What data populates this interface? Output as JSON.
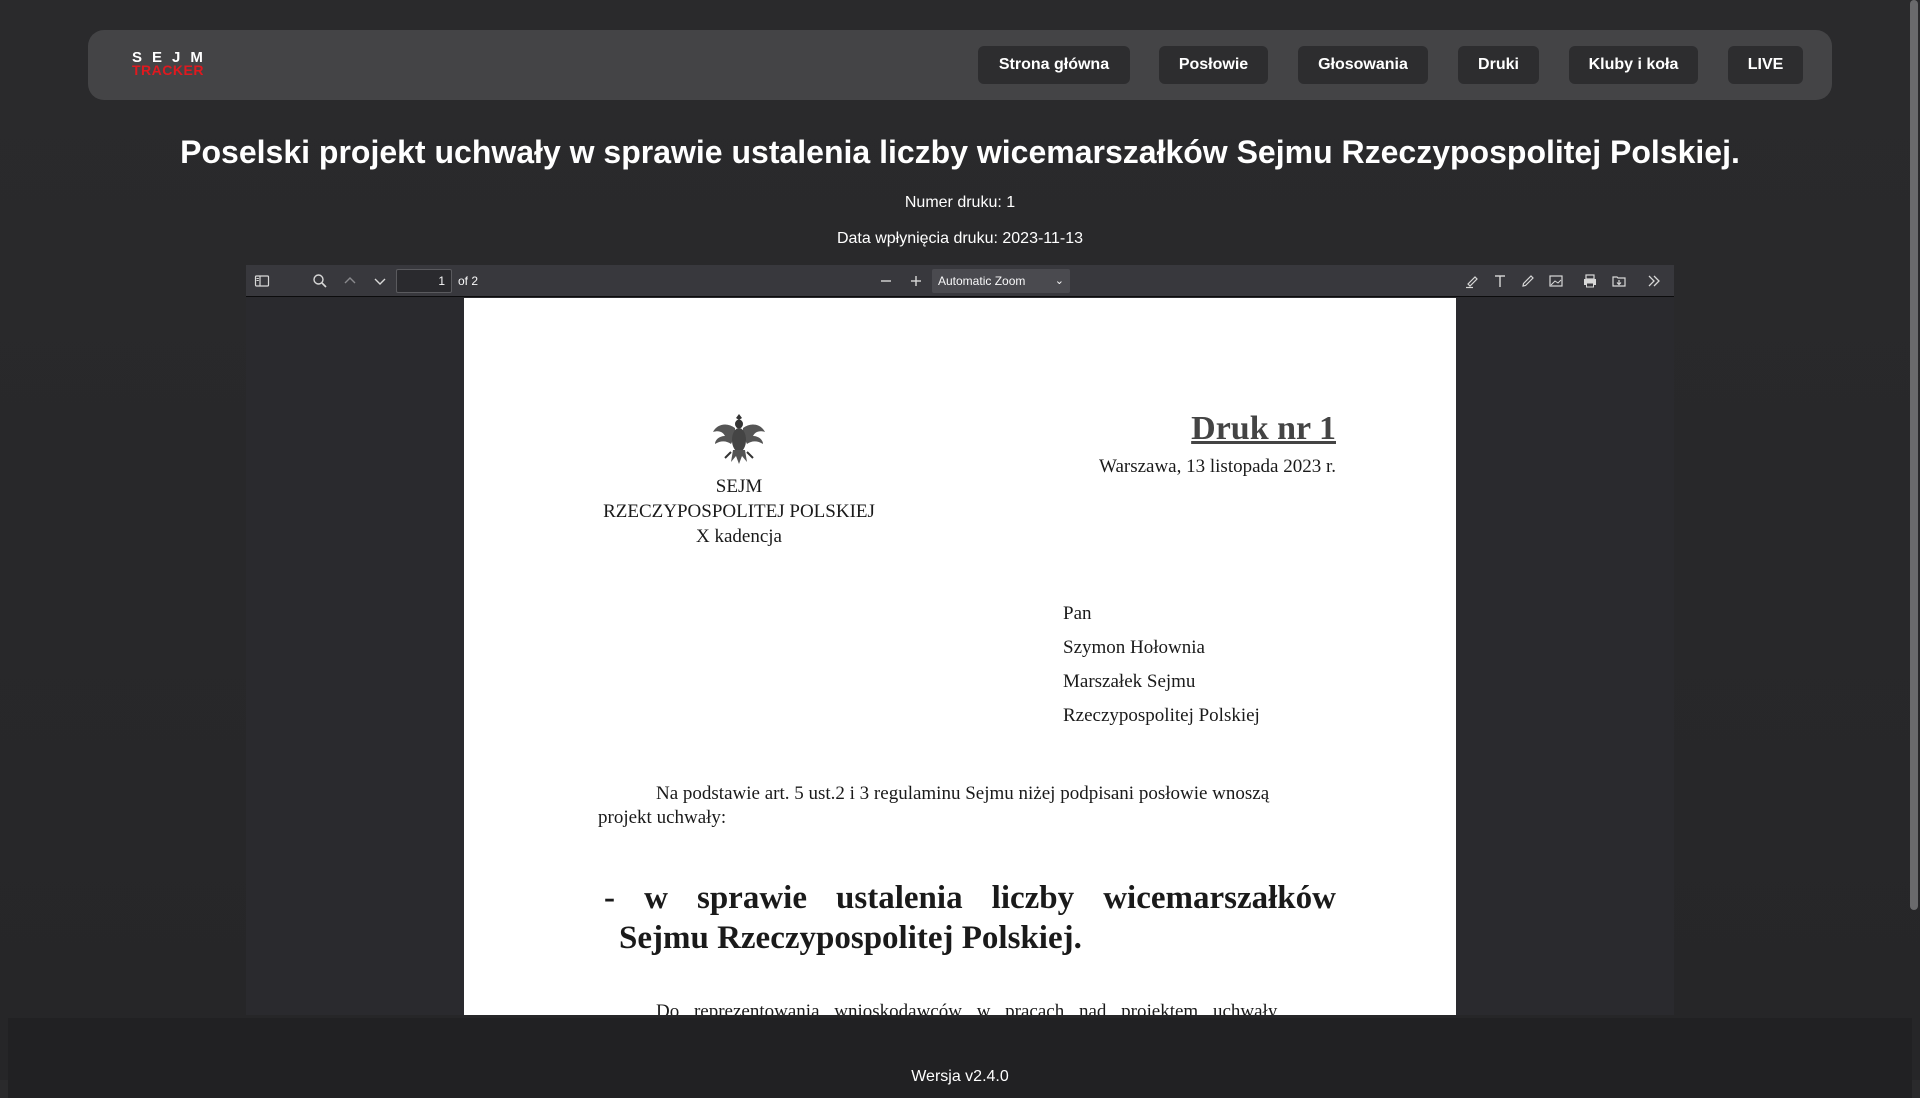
{
  "logo": {
    "top": "SEJM",
    "bottom": "TRACKER"
  },
  "nav": {
    "items": [
      {
        "label": "Strona główna"
      },
      {
        "label": "Posłowie"
      },
      {
        "label": "Głosowania"
      },
      {
        "label": "Druki"
      },
      {
        "label": "Kluby i koła"
      },
      {
        "label": "LIVE"
      }
    ]
  },
  "print": {
    "title": "Poselski projekt uchwały w sprawie ustalenia liczby wicemarszałków Sejmu Rzeczypospolitej Polskiej.",
    "number_line": "Numer druku: 1",
    "date_line": "Data wpłynięcia druku: 2023-11-13"
  },
  "viewer": {
    "page_value": "1",
    "page_count": "of 2",
    "zoom": "Automatic Zoom",
    "icons": {
      "sidebar": "sidebar-toggle-icon",
      "find": "search-icon",
      "prev": "chevron-up-icon",
      "next": "chevron-down-icon",
      "zoom_out": "minus-icon",
      "zoom_in": "plus-icon",
      "highlight": "highlighter-icon",
      "text": "text-icon",
      "draw": "pencil-icon",
      "image": "image-icon",
      "print": "printer-icon",
      "save": "download-icon",
      "more": "double-chevron-right-icon"
    }
  },
  "document": {
    "org_line1": "SEJM",
    "org_line2": "RZECZYPOSPOLITEJ POLSKIEJ",
    "org_line3": "X kadencja",
    "druk_title": "Druk nr 1",
    "place_date": "Warszawa, 13 listopada 2023 r.",
    "addressee": [
      "Pan",
      "Szymon Hołownia",
      "Marszałek Sejmu",
      "Rzeczypospolitej Polskiej"
    ],
    "para1_line1": "Na podstawie art. 5 ust.2 i 3  regulaminu Sejmu niżej podpisani posłowie wnoszą",
    "para1_line2": "projekt uchwały:",
    "heading_line1": "- w sprawie ustalenia liczby wicemarszałków",
    "heading_line2": "Sejmu Rzeczypospolitej Polskiej.",
    "para2_partial": "Do reprezentowania wnioskodawców w pracach nad projektem uchwały"
  },
  "footer": {
    "version": "Wersja v2.4.0"
  }
}
